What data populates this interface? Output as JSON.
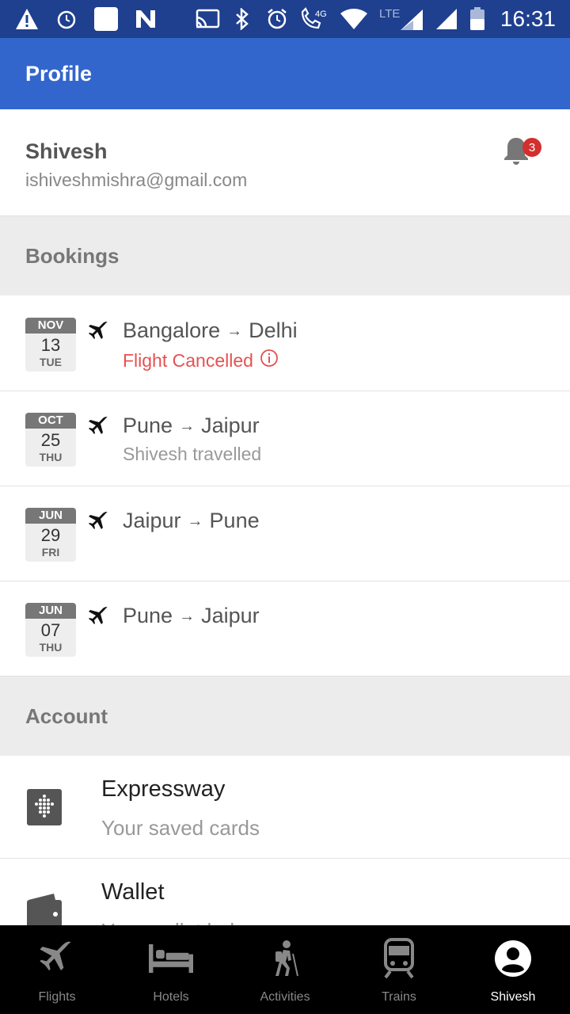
{
  "status_bar": {
    "time": "16:31",
    "network": "4G",
    "lte": "LTE"
  },
  "app_bar": {
    "title": "Profile"
  },
  "profile": {
    "name": "Shivesh",
    "email": "ishiveshmishra@gmail.com",
    "notifications": "3"
  },
  "sections": {
    "bookings": "Bookings",
    "account": "Account"
  },
  "bookings": [
    {
      "month": "NOV",
      "day": "13",
      "weekday": "TUE",
      "from": "Bangalore",
      "to": "Delhi",
      "status": "Flight Cancelled"
    },
    {
      "month": "OCT",
      "day": "25",
      "weekday": "THU",
      "from": "Pune",
      "to": "Jaipur",
      "status": "Shivesh travelled"
    },
    {
      "month": "JUN",
      "day": "29",
      "weekday": "FRI",
      "from": "Jaipur",
      "to": "Pune",
      "status": ""
    },
    {
      "month": "JUN",
      "day": "07",
      "weekday": "THU",
      "from": "Pune",
      "to": "Jaipur",
      "status": ""
    }
  ],
  "account": [
    {
      "title": "Expressway",
      "subtitle": "Your saved cards",
      "icon": "expressway-icon"
    },
    {
      "title": "Wallet",
      "subtitle": "Your wallet balance",
      "icon": "wallet-icon"
    }
  ],
  "arrow": "→",
  "bottom_nav": [
    {
      "label": "Flights",
      "icon": "plane-icon"
    },
    {
      "label": "Hotels",
      "icon": "bed-icon"
    },
    {
      "label": "Activities",
      "icon": "hiker-icon"
    },
    {
      "label": "Trains",
      "icon": "train-icon"
    },
    {
      "label": "Shivesh",
      "icon": "avatar-icon",
      "active": true
    }
  ],
  "colors": {
    "app_bar": "#3366cc",
    "status_bar": "#1f3f8f",
    "cancelled": "#e65151",
    "badge": "#d32f2f"
  }
}
